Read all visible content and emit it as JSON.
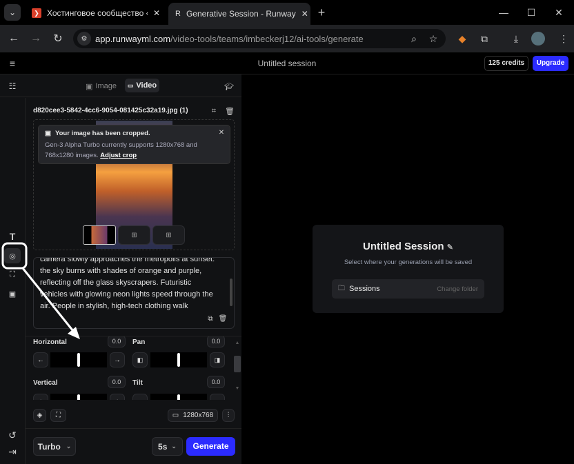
{
  "browser": {
    "tabs": [
      {
        "title": "Хостинговое сообщество «Tim"
      },
      {
        "title": "Generative Session - Runway"
      }
    ],
    "url_host": "app.runwayml.com",
    "url_path": "/video-tools/teams/imbeckerj12/ai-tools/generate"
  },
  "header": {
    "title": "Untitled session",
    "credits": "125 credits",
    "upgrade": "Upgrade"
  },
  "mode_tabs": [
    {
      "label": "Image"
    },
    {
      "label": "Video"
    }
  ],
  "file": {
    "name": "d820cee3-5842-4cc6-9054-081425c32a19.jpg (1)"
  },
  "toast": {
    "title": "Your image has been cropped.",
    "body": "Gen-3 Alpha Turbo currently supports 1280x768 and 768x1280 images.",
    "link": "Adjust crop"
  },
  "prompt": "camera slowly approaches the metropolis at sunset: the sky burns with shades of orange and purple, reflecting off the glass skyscrapers. Futuristic vehicles with glowing neon lights speed through the air. People in stylish, high-tech clothing walk",
  "camera": {
    "horizontal": {
      "label": "Horizontal",
      "value": "0.0"
    },
    "pan": {
      "label": "Pan",
      "value": "0.0"
    },
    "vertical": {
      "label": "Vertical",
      "value": "0.0"
    },
    "tilt": {
      "label": "Tilt",
      "value": "0.0"
    }
  },
  "resolution": "1280x768",
  "footer": {
    "model": "Turbo",
    "duration": "5s",
    "generate": "Generate"
  },
  "session_card": {
    "title": "Untitled Session",
    "subtitle": "Select where your generations will be saved",
    "folder": "Sessions",
    "change": "Change folder"
  },
  "colors": {
    "accent": "#2b2bff"
  }
}
